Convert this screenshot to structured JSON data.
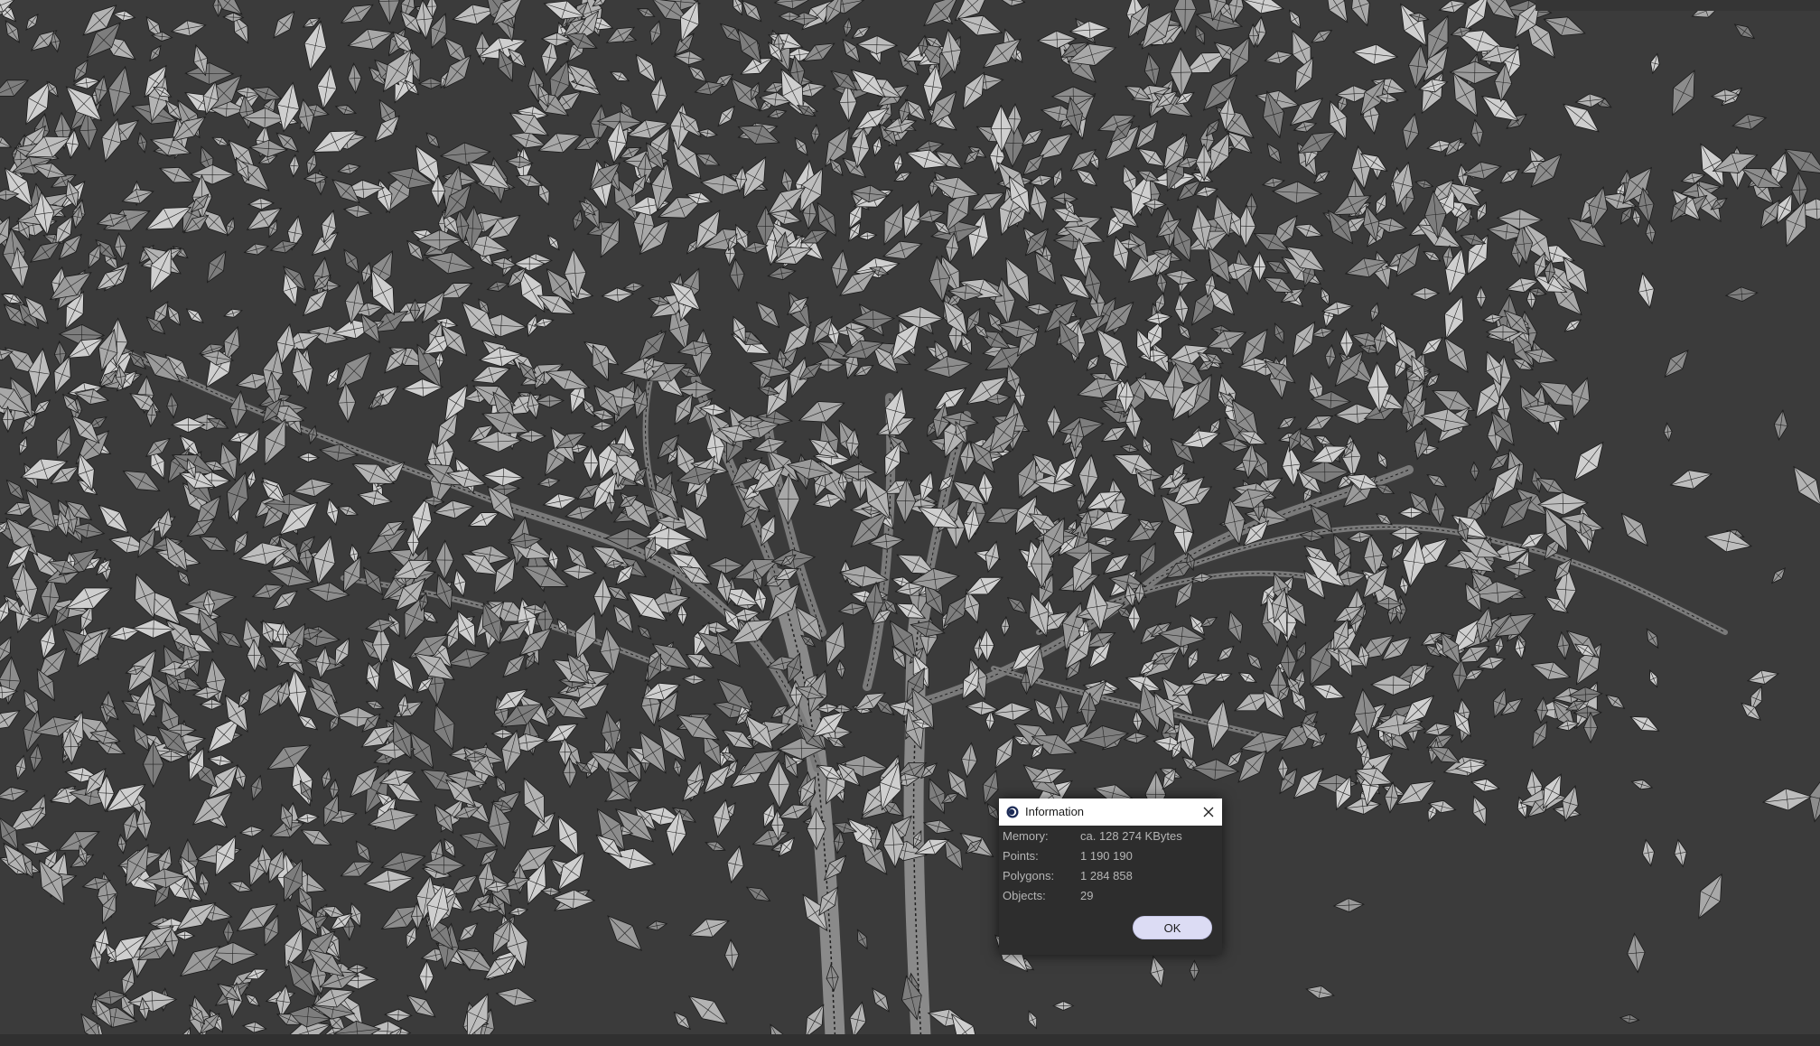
{
  "viewport": {
    "background": "#3b3b3b",
    "content": "tree-wireframe"
  },
  "dialog": {
    "title": "Information",
    "icon": "cinema4d-app-icon",
    "close_icon": "close-icon",
    "rows": [
      {
        "label": "Memory:",
        "value": "ca. 128 274 KBytes"
      },
      {
        "label": "Points:",
        "value": "1 190 190"
      },
      {
        "label": "Polygons:",
        "value": "1 284 858"
      },
      {
        "label": "Objects:",
        "value": "29"
      }
    ],
    "ok_label": "OK",
    "ok_color": "#dcdcf4"
  }
}
